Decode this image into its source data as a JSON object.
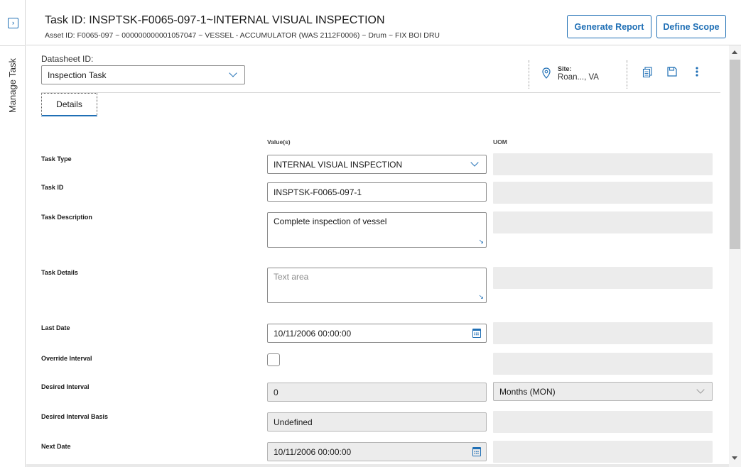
{
  "rail": {
    "label": "Manage Task",
    "toggle_icon": "panel-expand-icon"
  },
  "header": {
    "title": "Task ID: INSPTSK-F0065-097-1~INTERNAL VISUAL INSPECTION",
    "subtitle": "Asset ID: F0065-097 ~ 000000000001057047 ~ VESSEL - ACCUMULATOR (WAS 2112F0006) ~ Drum ~ FIX BOI DRU",
    "buttons": {
      "generate_report": "Generate Report",
      "define_scope": "Define Scope"
    }
  },
  "datasheet": {
    "label": "Datasheet ID:",
    "selected": "Inspection Task"
  },
  "site": {
    "title": "Site:",
    "value": "Roan..., VA"
  },
  "toolbar": {
    "icons": [
      "copy-datasheet-icon",
      "save-icon",
      "more-options-icon"
    ]
  },
  "tabs": [
    {
      "label": "Details"
    }
  ],
  "columns": {
    "values": "Value(s)",
    "uom": "UOM"
  },
  "fields": {
    "task_type": {
      "label": "Task Type",
      "value": "INTERNAL VISUAL INSPECTION"
    },
    "task_id": {
      "label": "Task ID",
      "value": "INSPTSK-F0065-097-1"
    },
    "task_description": {
      "label": "Task Description",
      "value": "Complete inspection of vessel"
    },
    "task_details": {
      "label": "Task Details",
      "value": "",
      "placeholder": "Text area"
    },
    "last_date": {
      "label": "Last Date",
      "value": "10/11/2006 00:00:00"
    },
    "override_interval": {
      "label": "Override Interval",
      "checked": false
    },
    "desired_interval": {
      "label": "Desired Interval",
      "value": "0",
      "uom": "Months (MON)"
    },
    "desired_interval_basis": {
      "label": "Desired Interval Basis",
      "value": "Undefined"
    },
    "next_date": {
      "label": "Next Date",
      "value": "10/11/2006 00:00:00"
    }
  },
  "colors": {
    "accent": "#1f6fb5",
    "readonly_bg": "#ececec",
    "border": "#8c8c8c"
  }
}
